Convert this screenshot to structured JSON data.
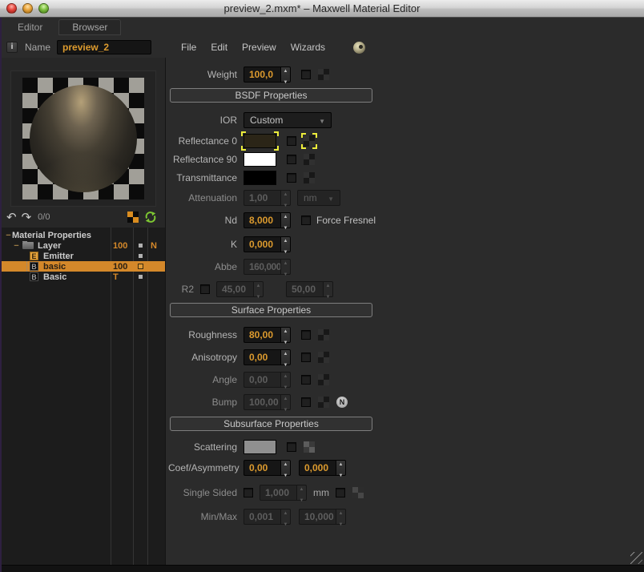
{
  "window": {
    "title": "preview_2.mxm* – Maxwell Material Editor"
  },
  "tabs": {
    "editor": "Editor",
    "browser": "Browser"
  },
  "name_row": {
    "info": "i",
    "label": "Name",
    "value": "preview_2"
  },
  "menu": {
    "file": "File",
    "edit": "Edit",
    "preview": "Preview",
    "wizards": "Wizards"
  },
  "left": {
    "history_count": "0/0",
    "tree": {
      "root": {
        "label": "Material Properties"
      },
      "layer": {
        "label": "Layer",
        "value": "100",
        "flag": "N"
      },
      "emitter": {
        "badge": "E",
        "label": "Emitter"
      },
      "basic_selected": {
        "badge": "B",
        "label": "basic",
        "value": "100"
      },
      "basic": {
        "badge": "B",
        "label": "Basic",
        "value": "T"
      }
    }
  },
  "props": {
    "weight": {
      "label": "Weight",
      "value": "100,0"
    },
    "bsdf_header": "BSDF Properties",
    "ior": {
      "label": "IOR",
      "value": "Custom"
    },
    "reflectance0": {
      "label": "Reflectance 0",
      "color": "#2b2517"
    },
    "reflectance90": {
      "label": "Reflectance 90",
      "color": "#ffffff"
    },
    "transmittance": {
      "label": "Transmittance",
      "color": "#000000"
    },
    "attenuation": {
      "label": "Attenuation",
      "value": "1,00",
      "unit": "nm"
    },
    "nd": {
      "label": "Nd",
      "value": "8,000",
      "checkbox_label": "Force Fresnel"
    },
    "k": {
      "label": "K",
      "value": "0,000"
    },
    "abbe": {
      "label": "Abbe",
      "value": "160,000"
    },
    "r2": {
      "label": "R2",
      "value1": "45,00",
      "value2": "50,00"
    },
    "surface_header": "Surface Properties",
    "roughness": {
      "label": "Roughness",
      "value": "80,00"
    },
    "anisotropy": {
      "label": "Anisotropy",
      "value": "0,00"
    },
    "angle": {
      "label": "Angle",
      "value": "0,00"
    },
    "bump": {
      "label": "Bump",
      "value": "100,00",
      "n_badge": "N"
    },
    "subsurface_header": "Subsurface Properties",
    "scattering": {
      "label": "Scattering",
      "color": "#8f8f8f"
    },
    "coef_asymmetry": {
      "label": "Coef/Asymmetry",
      "value1": "0,00",
      "value2": "0,000"
    },
    "single_sided": {
      "label": "Single Sided",
      "value": "1,000",
      "unit": "mm"
    },
    "minmax": {
      "label": "Min/Max",
      "value1": "0,001",
      "value2": "10,000"
    }
  },
  "colors": {
    "accent_orange": "#dd9b2e",
    "selection_orange": "#d4882a",
    "bracket_yellow": "#ecec3a",
    "refresh_green": "#7ec832",
    "panel_bg": "#2b2b2b",
    "tree_bg": "#1c1c1c"
  }
}
